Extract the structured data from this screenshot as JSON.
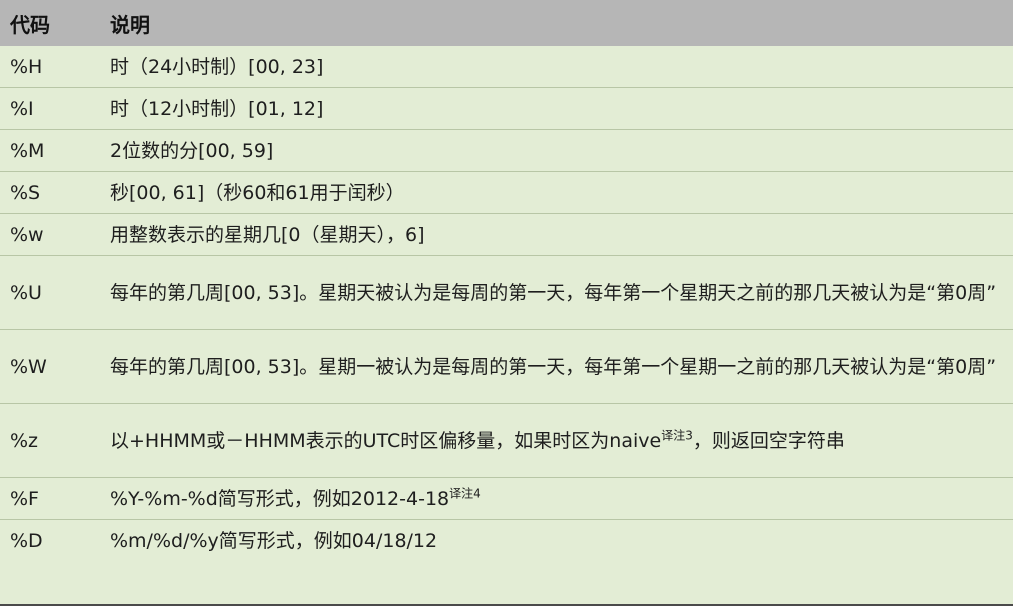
{
  "header": {
    "code": "代码",
    "desc": "说明"
  },
  "rows": [
    {
      "code": "%H",
      "desc": "时（24小时制）[00, 23]"
    },
    {
      "code": "%I",
      "desc": "时（12小时制）[01, 12]"
    },
    {
      "code": "%M",
      "desc": "2位数的分[00, 59]"
    },
    {
      "code": "%S",
      "desc": "秒[00, 61]（秒60和61用于闰秒）"
    },
    {
      "code": "%w",
      "desc": "用整数表示的星期几[0（星期天），6]"
    },
    {
      "code": "%U",
      "desc": "每年的第几周[00, 53]。星期天被认为是每周的第一天，每年第一个星期天之前的那几天被认为是“第0周”"
    },
    {
      "code": "%W",
      "desc": "每年的第几周[00, 53]。星期一被认为是每周的第一天，每年第一个星期一之前的那几天被认为是“第0周”"
    },
    {
      "code": "%z",
      "desc_before": "以+HHMM或－HHMM表示的UTC时区偏移量，如果时区为naive",
      "note": "译注3",
      "desc_after": "，则返回空字符串"
    },
    {
      "code": "%F",
      "desc_before": "%Y-%m-%d简写形式，例如2012-4-18",
      "note": "译注4",
      "desc_after": ""
    },
    {
      "code": "%D",
      "desc": "%m/%d/%y简写形式，例如04/18/12"
    }
  ]
}
